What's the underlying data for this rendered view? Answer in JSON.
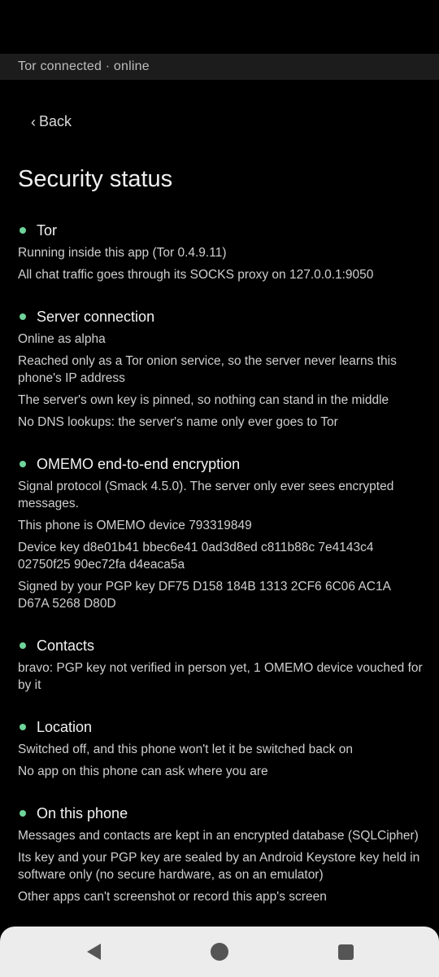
{
  "banner": {
    "text": "Tor connected · online"
  },
  "nav": {
    "back_label": "Back",
    "back_chevron": "‹"
  },
  "page": {
    "title": "Security status"
  },
  "accent_color": "#6fd49a",
  "sections": [
    {
      "title": "Tor",
      "lines": [
        "Running inside this app (Tor 0.4.9.11)",
        "All chat traffic goes through its SOCKS proxy on 127.0.0.1:9050"
      ]
    },
    {
      "title": "Server connection",
      "lines": [
        "Online as alpha",
        "Reached only as a Tor onion service, so the server never learns this phone's IP address",
        "The server's own key is pinned, so nothing can stand in the middle",
        "No DNS lookups: the server's name only ever goes to Tor"
      ]
    },
    {
      "title": "OMEMO end-to-end encryption",
      "lines": [
        "Signal protocol (Smack 4.5.0). The server only ever sees encrypted messages.",
        "This phone is OMEMO device 793319849",
        "Device key d8e01b41 bbec6e41 0ad3d8ed c811b88c 7e4143c4 02750f25 90ec72fa d4eaca5a",
        "Signed by your PGP key DF75 D158 184B 1313 2CF6 6C06 AC1A D67A 5268 D80D"
      ]
    },
    {
      "title": "Contacts",
      "lines": [
        "bravo: PGP key not verified in person yet, 1 OMEMO device vouched for by it"
      ]
    },
    {
      "title": "Location",
      "lines": [
        "Switched off, and this phone won't let it be switched back on",
        "No app on this phone can ask where you are"
      ]
    },
    {
      "title": "On this phone",
      "lines": [
        "Messages and contacts are kept in an encrypted database (SQLCipher)",
        "Its key and your PGP key are sealed by an Android Keystore key held in software only (no secure hardware, as on an emulator)",
        "Other apps can't screenshot or record this app's screen"
      ]
    }
  ],
  "system_nav": {
    "back_icon": "triangle-back-icon",
    "home_icon": "circle-home-icon",
    "recents_icon": "square-recents-icon"
  }
}
